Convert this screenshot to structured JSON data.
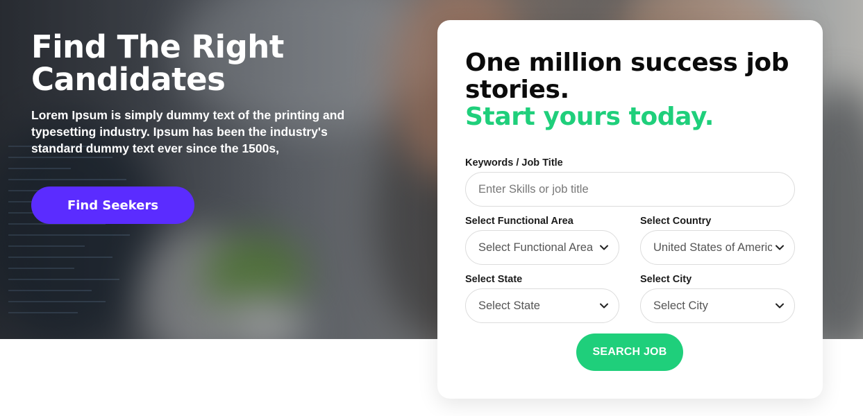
{
  "hero": {
    "title": "Find The Right Candidates",
    "description": "Lorem Ipsum is simply dummy text of the printing and typesetting industry. Ipsum has been the industry's standard dummy text ever since the 1500s,",
    "cta_label": "Find Seekers"
  },
  "search_card": {
    "heading": "One million success job stories.",
    "heading_accent": "Start yours today.",
    "keywords": {
      "label": "Keywords / Job Title",
      "placeholder": "Enter Skills or job title",
      "value": ""
    },
    "functional_area": {
      "label": "Select Functional Area",
      "selected": "Select Functional Area"
    },
    "country": {
      "label": "Select Country",
      "selected": "United States of America"
    },
    "state": {
      "label": "Select State",
      "selected": "Select State"
    },
    "city": {
      "label": "Select City",
      "selected": "Select City"
    },
    "submit_label": "SEARCH JOB"
  },
  "icons": {
    "select_arrow": "chevron-down-icon"
  },
  "colors": {
    "brand_purple": "#5b2cff",
    "accent_green": "#1fcf7b",
    "heading_dark": "#0b0b0b"
  }
}
